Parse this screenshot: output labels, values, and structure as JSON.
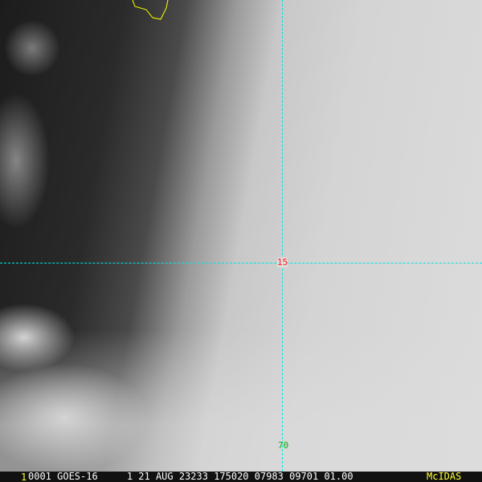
{
  "grid": {
    "latitude_label": "15",
    "longitude_label": "70",
    "grid_color": "#00e5e5"
  },
  "footer": {
    "frame_marker": "1",
    "info": "0001 GOES-16     1 21 AUG 23233 175020 07983 09701 01.00",
    "brand": "McIDAS"
  },
  "colors": {
    "coastline": "#ffff00",
    "latitude_label": "#ff2020",
    "longitude_label": "#10b010",
    "footer_text": "#ffffff",
    "footer_highlight": "#ffff30"
  }
}
